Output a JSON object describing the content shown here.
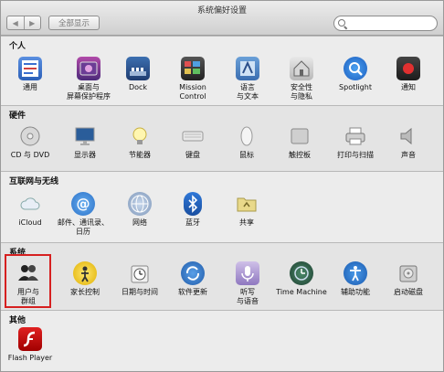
{
  "window": {
    "title": "系统偏好设置"
  },
  "toolbar": {
    "back": "◀",
    "forward": "▶",
    "show_all_label": "全部显示",
    "search_placeholder": ""
  },
  "sections": [
    {
      "title": "个人",
      "items": [
        {
          "label": "通用",
          "icon": "general-icon"
        },
        {
          "label": "桌面与\n屏幕保护程序",
          "icon": "desktop-screensaver-icon"
        },
        {
          "label": "Dock",
          "icon": "dock-icon"
        },
        {
          "label": "Mission\nControl",
          "icon": "mission-control-icon"
        },
        {
          "label": "语言\n与文本",
          "icon": "language-text-icon"
        },
        {
          "label": "安全性\n与隐私",
          "icon": "security-privacy-icon"
        },
        {
          "label": "Spotlight",
          "icon": "spotlight-icon"
        },
        {
          "label": "通知",
          "icon": "notifications-icon"
        }
      ]
    },
    {
      "title": "硬件",
      "items": [
        {
          "label": "CD 与 DVD",
          "icon": "cd-dvd-icon"
        },
        {
          "label": "显示器",
          "icon": "displays-icon"
        },
        {
          "label": "节能器",
          "icon": "energy-saver-icon"
        },
        {
          "label": "键盘",
          "icon": "keyboard-icon"
        },
        {
          "label": "鼠标",
          "icon": "mouse-icon"
        },
        {
          "label": "触控板",
          "icon": "trackpad-icon"
        },
        {
          "label": "打印与扫描",
          "icon": "print-scan-icon"
        },
        {
          "label": "声音",
          "icon": "sound-icon"
        }
      ]
    },
    {
      "title": "互联网与无线",
      "items": [
        {
          "label": "iCloud",
          "icon": "icloud-icon"
        },
        {
          "label": "邮件、通讯录、\n日历",
          "icon": "mail-contacts-calendars-icon"
        },
        {
          "label": "网络",
          "icon": "network-icon"
        },
        {
          "label": "蓝牙",
          "icon": "bluetooth-icon"
        },
        {
          "label": "共享",
          "icon": "sharing-icon"
        }
      ]
    },
    {
      "title": "系统",
      "items": [
        {
          "label": "用户与\n群组",
          "icon": "users-groups-icon"
        },
        {
          "label": "家长控制",
          "icon": "parental-controls-icon"
        },
        {
          "label": "日期与时间",
          "icon": "date-time-icon"
        },
        {
          "label": "软件更新",
          "icon": "software-update-icon"
        },
        {
          "label": "听写\n与语音",
          "icon": "dictation-speech-icon"
        },
        {
          "label": "Time Machine",
          "icon": "time-machine-icon"
        },
        {
          "label": "辅助功能",
          "icon": "accessibility-icon"
        },
        {
          "label": "启动磁盘",
          "icon": "startup-disk-icon"
        }
      ]
    },
    {
      "title": "其他",
      "items": [
        {
          "label": "Flash Player",
          "icon": "flash-player-icon"
        }
      ]
    }
  ],
  "colors": {
    "highlight_border": "#d62020"
  }
}
